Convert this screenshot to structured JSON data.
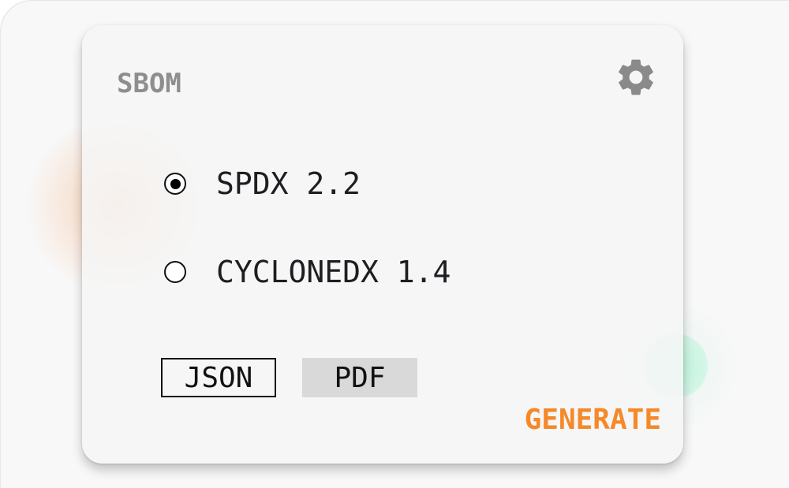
{
  "sbom_panel": {
    "title": "SBOM",
    "settings_icon": "gear-icon",
    "options": [
      {
        "label": "SPDX 2.2",
        "selected": true
      },
      {
        "label": "CYCLONEDX 1.4",
        "selected": false
      }
    ],
    "formats": [
      {
        "label": "JSON",
        "selected": true
      },
      {
        "label": "PDF",
        "selected": false
      }
    ],
    "generate_label": "GENERATE"
  },
  "colors": {
    "accent": "#f5892a",
    "title": "#8e8e8e",
    "text": "#1e1e22",
    "pdf_button_bg": "#d9d9d9",
    "card_bg": "#f6f6f6",
    "orange_glow": "#f2aa78",
    "mint_glow": "#bef5dc"
  }
}
